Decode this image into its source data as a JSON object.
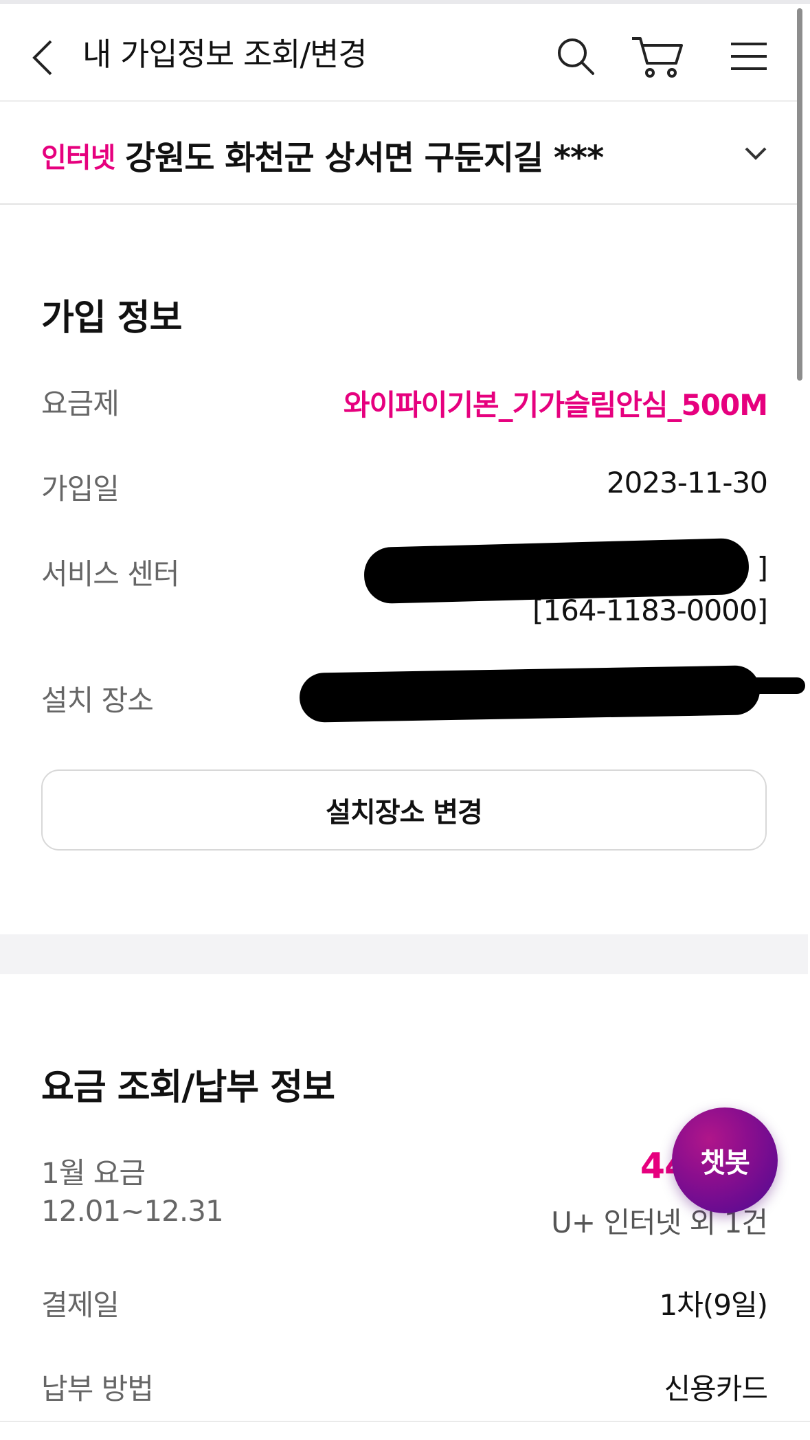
{
  "header": {
    "title": "내 가입정보 조회/변경"
  },
  "service": {
    "type": "인터넷",
    "address": "강원도 화천군 상서면 구둔지길 ***"
  },
  "subscription": {
    "title": "가입 정보",
    "plan_label": "요금제",
    "plan_value": "와이파이기본_기가슬림안심_500M",
    "join_date_label": "가입일",
    "join_date_value": "2023-11-30",
    "service_center_label": "서비스 센터",
    "service_center_tail": "]",
    "service_center_phone": "[164-1183-0000]",
    "install_location_label": "설치 장소",
    "change_location_button": "설치장소 변경"
  },
  "billing": {
    "title": "요금 조회/납부 정보",
    "month_label": "1월 요금",
    "period": "12.01~12.31",
    "amount_partial": "44,",
    "summary": "U+ 인터넷 외 1건",
    "payment_day_label": "결제일",
    "payment_day_value": "1차(9일)",
    "payment_method_label": "납부 방법",
    "payment_method_value": "신용카드"
  },
  "chatbot": {
    "label": "챗봇"
  },
  "colors": {
    "accent": "#e6007e",
    "chatbot_gradient_start": "#b0168a",
    "chatbot_gradient_end": "#4d0a93"
  }
}
